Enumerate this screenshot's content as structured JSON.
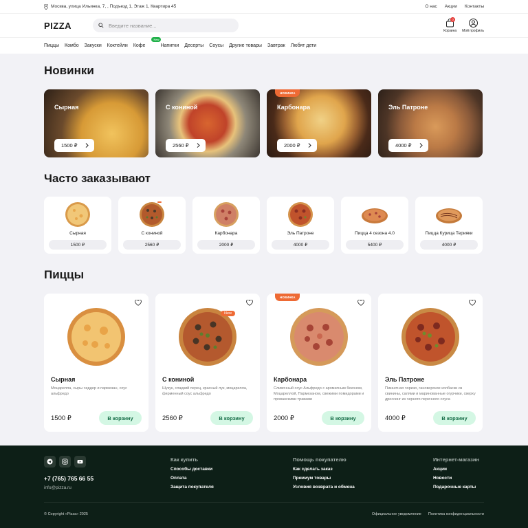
{
  "topbar": {
    "address": "Москва, улица Ильинка, 7, , Подъезд 1, Этаж 1, Квартира 45",
    "links": [
      "О нас",
      "Акции",
      "Контакты"
    ]
  },
  "header": {
    "logo": "PIZZA",
    "search_placeholder": "Введите название...",
    "cart_label": "Корзина",
    "cart_count": "0",
    "profile_label": "Мой профиль"
  },
  "nav": {
    "items": [
      "Пиццы",
      "Комбо",
      "Закуски",
      "Коктейли",
      "Кофе",
      "Напитки",
      "Десерты",
      "Соусы",
      "Другие товары",
      "Завтрак",
      "Любят дети"
    ],
    "new_badge": "New"
  },
  "sections": {
    "new": "Новинки",
    "frequent": "Часто заказывают",
    "pizzas": "Пиццы"
  },
  "new_items": [
    {
      "name": "Сырная",
      "price": "1500 ₽",
      "ribbon": ""
    },
    {
      "name": "С кониной",
      "price": "2560 ₽",
      "ribbon": ""
    },
    {
      "name": "Карбонара",
      "price": "2000 ₽",
      "ribbon": "НОВИНКА"
    },
    {
      "name": "Эль Патроне",
      "price": "4000 ₽",
      "ribbon": ""
    }
  ],
  "frequent_items": [
    {
      "name": "Сырная",
      "price": "1500 ₽"
    },
    {
      "name": "С кониной",
      "price": "2560 ₽"
    },
    {
      "name": "Карбонара",
      "price": "2000 ₽"
    },
    {
      "name": "Эль Патроне",
      "price": "4000 ₽"
    },
    {
      "name": "Пицца 4 сезона 4.0",
      "price": "5400 ₽"
    },
    {
      "name": "Пицца Курица Терияки",
      "price": "4000 ₽"
    }
  ],
  "pizzas": [
    {
      "name": "Сырная",
      "desc": "Моцарелла, сыры чеддер и пармезан, соус альфредо",
      "price": "1500 ₽",
      "button": "В корзину",
      "ribbon": "",
      "new": ""
    },
    {
      "name": "С кониной",
      "desc": "Шукук, сладкий перец, красный лук, моцарелла, фирменный соус альфредо",
      "price": "2560 ₽",
      "button": "В корзину",
      "ribbon": "",
      "new": "New"
    },
    {
      "name": "Карбонара",
      "desc": "Сливочный соус Альфредо с ароматным беконом, Моцареллой, Пармезаном, свежими помидорами и прованскими травами",
      "price": "2000 ₽",
      "button": "В корзину",
      "ribbon": "НОВИНКА",
      "new": ""
    },
    {
      "name": "Эль Патроне",
      "desc": "Пикантная чоризо, гановерские колбаски из свинины, салями и маринованные огурчики, сверху дрессинг из черного перечного соуса",
      "price": "4000 ₽",
      "button": "В корзину",
      "ribbon": "",
      "new": ""
    }
  ],
  "footer": {
    "phone": "+7 (765) 765 66 55",
    "email": "info@pizza.ru",
    "col1": {
      "title": "Как купить",
      "items": [
        "Способы доставки",
        "Оплата",
        "Защита покупателя"
      ]
    },
    "col2": {
      "title": "Помощь покупателю",
      "items": [
        "Как сделать заказ",
        "Премиум товары",
        "Условия возврата и обмена"
      ]
    },
    "col3": {
      "title": "Интернет-магазин",
      "items": [
        "Акции",
        "Новости",
        "Подарочные карты"
      ]
    },
    "copyright": "© Copyright «Pizza» 2025",
    "legal": [
      "Официальное уведомление",
      "Политика конфиденциальности"
    ]
  },
  "colors": {
    "accent": "#21b14a",
    "ribbon": "#ee6a34",
    "footer_bg": "#0d1f17",
    "button_bg": "#d4f7e4"
  }
}
